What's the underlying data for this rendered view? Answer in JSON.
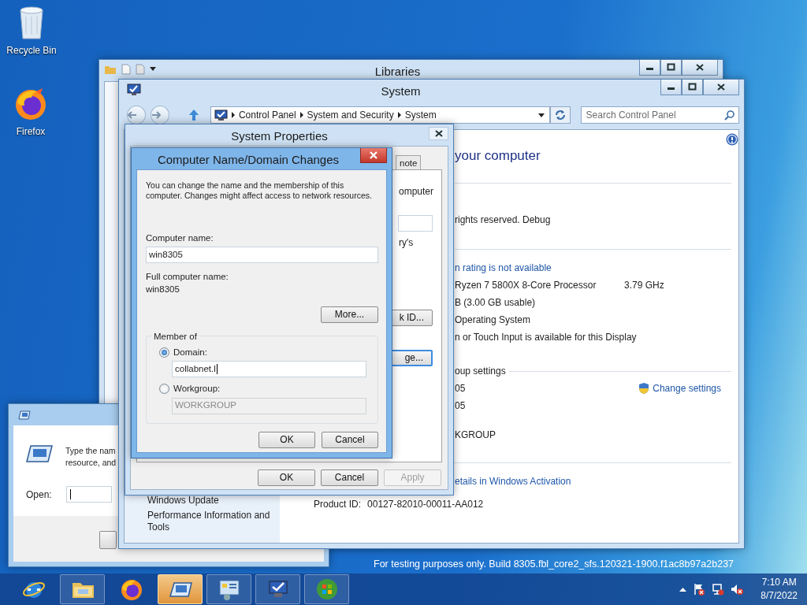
{
  "desktop_icons": [
    {
      "label": "Recycle Bin",
      "kind": "recycle"
    },
    {
      "label": "Firefox",
      "kind": "firefox"
    }
  ],
  "libraries_window": {
    "title": "Libraries"
  },
  "system_window": {
    "title": "System",
    "breadcrumbs": [
      "Control Panel",
      "System and Security",
      "System"
    ],
    "search": {
      "placeholder": "Search Control Panel"
    },
    "sidebar_items": [
      "Windows Update",
      "Performance Information and Tools"
    ],
    "main": [
      {
        "kind": "heading",
        "text": "your computer"
      },
      {
        "kind": "divider"
      },
      {
        "kind": "text",
        "text": "rights reserved. Debug"
      },
      {
        "kind": "divider"
      },
      {
        "kind": "link",
        "text": "n rating is not available"
      },
      {
        "kind": "spec",
        "text": "Ryzen 7 5800X 8-Core Processor",
        "value": "3.79 GHz"
      },
      {
        "kind": "text",
        "text": "B (3.00 GB usable)"
      },
      {
        "kind": "text",
        "text": "Operating System"
      },
      {
        "kind": "text",
        "text": "n or Touch Input is available for this Display"
      },
      {
        "kind": "section",
        "text": "oup settings"
      },
      {
        "kind": "setting",
        "text": "05",
        "link": "Change settings"
      },
      {
        "kind": "text",
        "text": "05"
      },
      {
        "kind": "spacer"
      },
      {
        "kind": "text",
        "text": "KGROUP"
      },
      {
        "kind": "divider"
      },
      {
        "kind": "link",
        "text": "etails in Windows Activation"
      },
      {
        "kind": "product",
        "text": "Product ID:",
        "value": "00127-82010-00011-AA012"
      }
    ]
  },
  "system_properties": {
    "title": "System Properties",
    "tabs": [
      {
        "label": "note",
        "selected": false
      }
    ],
    "fragments": [
      {
        "kind": "text",
        "text": "omputer"
      },
      {
        "kind": "field"
      },
      {
        "kind": "text",
        "text": "ry's"
      },
      {
        "kind": "button",
        "text": "k ID...",
        "focused": false
      },
      {
        "kind": "button",
        "text": "ge...",
        "focused": true
      }
    ],
    "buttons": [
      {
        "label": "OK",
        "disabled": false
      },
      {
        "label": "Cancel",
        "disabled": false
      },
      {
        "label": "Apply",
        "disabled": true
      }
    ]
  },
  "domain_dialog": {
    "title": "Computer Name/Domain Changes",
    "intro": "You can change the name and the membership of this computer. Changes might affect access to network resources.",
    "computer_name_label": "Computer name:",
    "computer_name": "win8305",
    "full_name_label": "Full computer name:",
    "full_name": "win8305",
    "more_button": "More...",
    "member_of": {
      "legend": "Member of",
      "options": [
        {
          "label": "Domain:",
          "selected": true,
          "value": "collabnet.l",
          "disabled": false
        },
        {
          "label": "Workgroup:",
          "selected": false,
          "value": "WORKGROUP",
          "disabled": true
        }
      ]
    },
    "buttons": [
      "OK",
      "Cancel"
    ]
  },
  "run_dialog": {
    "prompt_lines": [
      "Type the nam",
      "resource, and"
    ],
    "open_label": "Open:"
  },
  "build_notice": "For testing purposes only. Build 8305.fbl_core2_sfs.120321-1900.f1ac8b97a2b237",
  "taskbar": {
    "items": [
      {
        "kind": "ie",
        "active": false
      },
      {
        "kind": "explorer",
        "active": false
      },
      {
        "kind": "firefox",
        "active": false
      },
      {
        "kind": "run",
        "active": true
      },
      {
        "kind": "control_panel",
        "active": false
      },
      {
        "kind": "system",
        "active": false
      },
      {
        "kind": "media",
        "active": false
      }
    ],
    "clock": {
      "time": "7:10 AM",
      "date": "8/7/2022"
    }
  }
}
